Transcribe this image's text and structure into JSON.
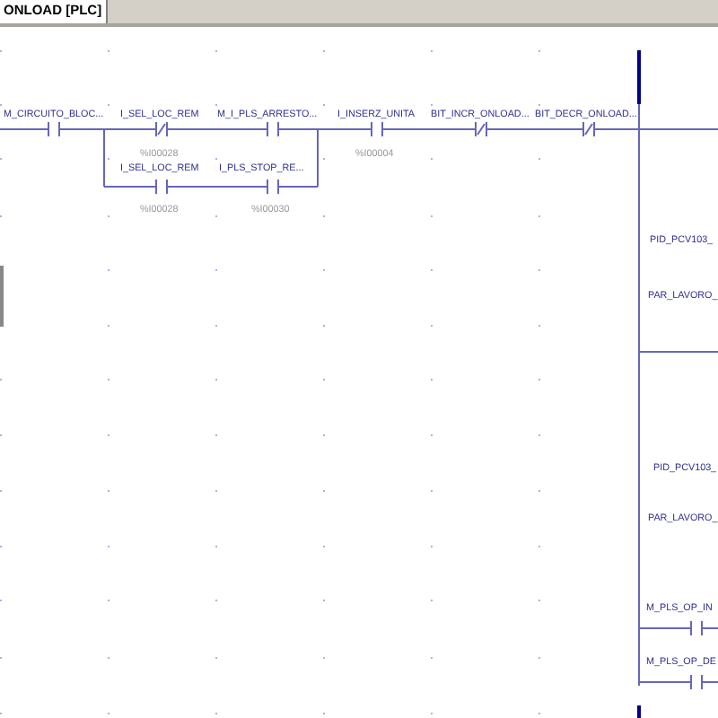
{
  "tab": {
    "label": "ONLOAD [PLC]",
    "selected": true
  },
  "main_rung": [
    {
      "label": "M_CIRCUITO_BLOC...",
      "kind": "normally_open"
    },
    {
      "label": "I_SEL_LOC_REM",
      "kind": "normally_closed",
      "address": "%I00028"
    },
    {
      "label": "M_I_PLS_ARRESTO...",
      "kind": "normally_open"
    },
    {
      "label": "I_INSERZ_UNITA",
      "kind": "normally_open",
      "address": "%I00004"
    },
    {
      "label": "BIT_INCR_ONLOAD...",
      "kind": "normally_closed"
    },
    {
      "label": "BIT_DECR_ONLOAD...",
      "kind": "normally_closed"
    }
  ],
  "branch": [
    {
      "label": "I_SEL_LOC_REM",
      "kind": "normally_open",
      "address": "%I00028"
    },
    {
      "label": "I_PLS_STOP_RE...",
      "kind": "normally_open",
      "address": "%I00030"
    }
  ],
  "right_column": [
    {
      "label": "PID_PCV103_"
    },
    {
      "label": "PAR_LAVORO_"
    },
    {
      "label": "PID_PCV103_"
    },
    {
      "label": "PAR_LAVORO_"
    },
    {
      "label": "M_PLS_OP_IN",
      "kind": "normally_open"
    },
    {
      "label": "M_PLS_OP_DE",
      "kind": "normally_open"
    }
  ]
}
